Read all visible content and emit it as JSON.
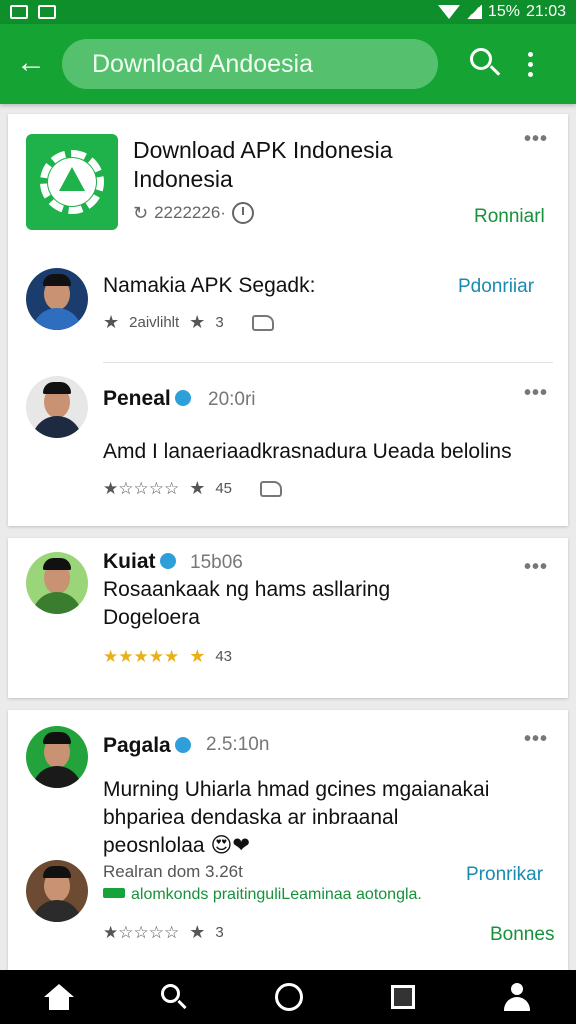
{
  "status_bar": {
    "battery": "15%",
    "time": "21:03"
  },
  "search": {
    "query": "Download Andoesia"
  },
  "app_card": {
    "title_line1": "Download APK Indonesia",
    "title_line2": "Indonesia",
    "meta": "2222226·",
    "action": "Ronniarl",
    "reviewer": {
      "name": "Namakia APK Segadk:",
      "rating_stars": "★★★★★",
      "rating_label": "2aivlihlt",
      "rating_count": "3",
      "action": "Pdonriiar"
    },
    "review2": {
      "name": "Peneal",
      "time": "20:0ri",
      "text": "Amd I lanaeriaadkrasnadura Ueada belolins",
      "stars": "★☆☆☆☆",
      "rating_count": "45"
    }
  },
  "card2": {
    "name": "Kuiat",
    "time": "15b06",
    "text_line1": "Rosaankaak ng hams asllaring",
    "text_line2": "Dogeloera",
    "stars": "★★★★★",
    "rating_count": "43"
  },
  "card3": {
    "name": "Pagala",
    "time": "2.5:10n",
    "text_line1": "Murning Uhiarla hmad gcines mgaianakai",
    "text_line2": "bhpariea dendaska ar inbraanal",
    "text_line3": "peosnlolaa",
    "emoji": "😍❤",
    "reply_meta": "Realran dom 3.26t",
    "reply_action": "Pronrikar",
    "reply_text": "alomkonds praitinguliLeaminaa aotongla.",
    "stars": "★☆☆☆☆",
    "rating_count": "3",
    "bottom_action": "Bonnes"
  }
}
